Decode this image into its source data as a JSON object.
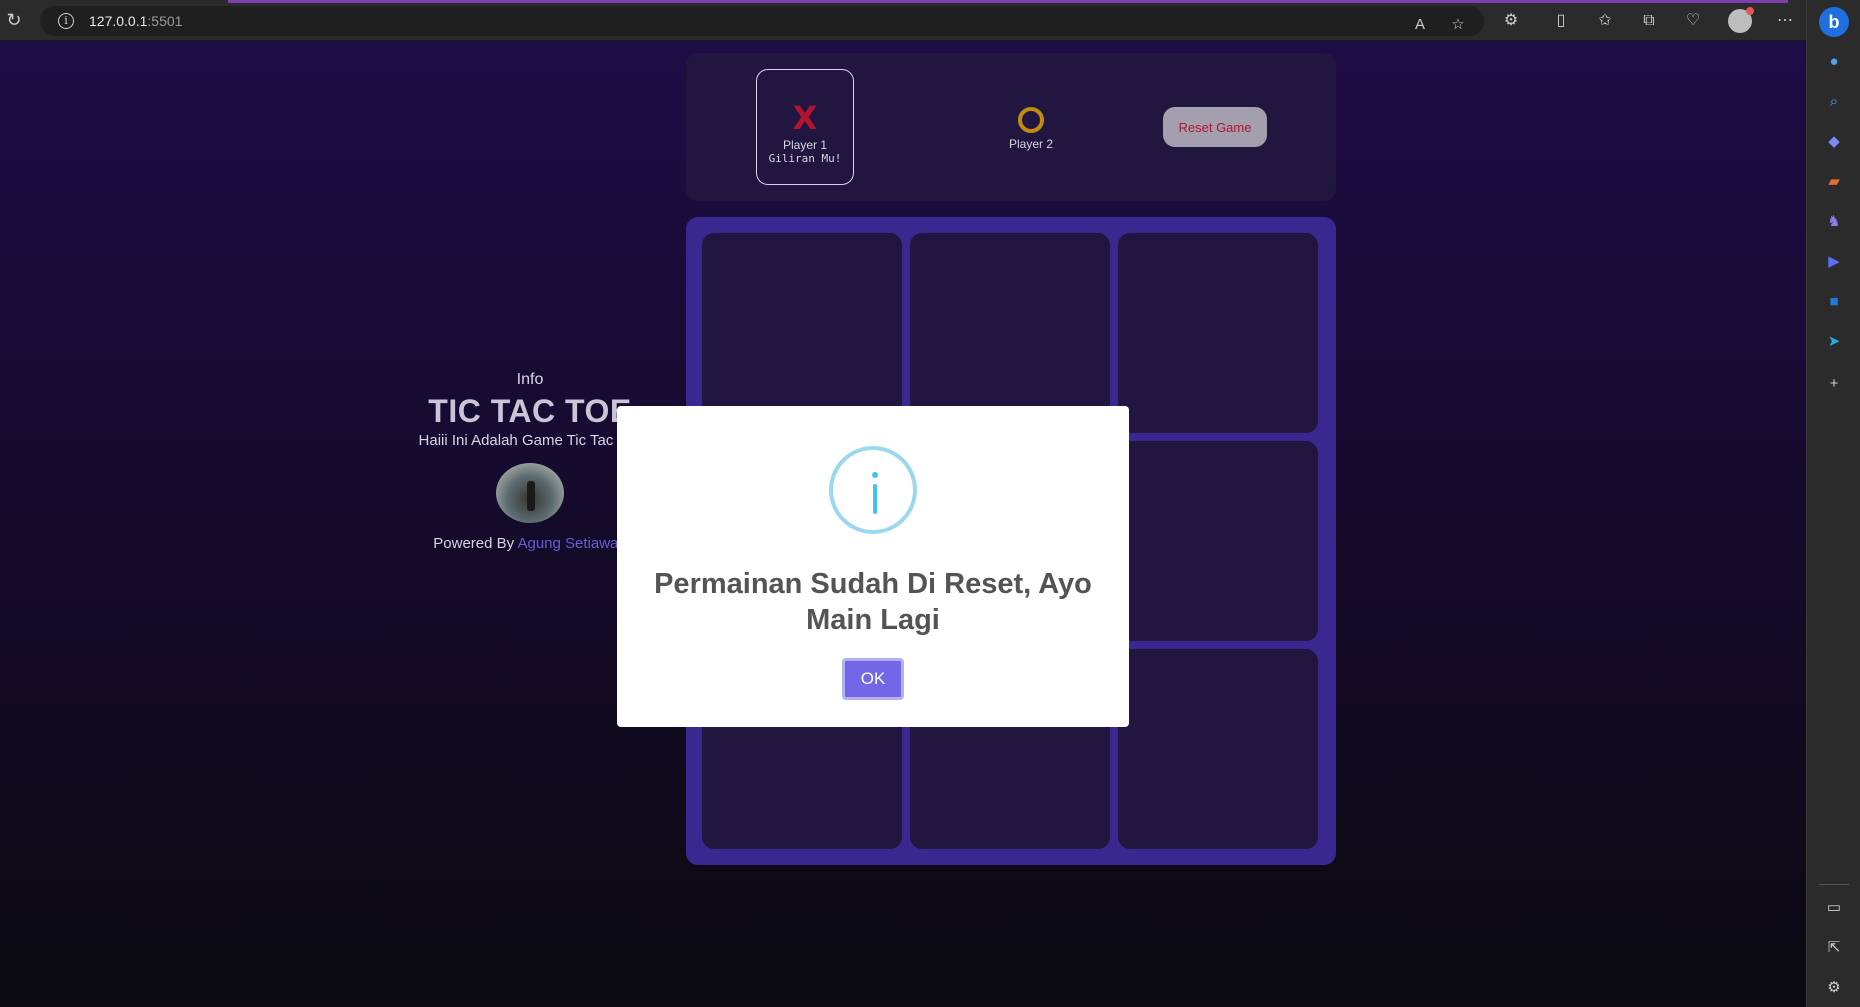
{
  "browser": {
    "url_host": "127.0.0.1",
    "url_port": ":5501"
  },
  "info": {
    "label": "Info",
    "title": "TIC TAC TOE",
    "description": "Haiii Ini Adalah Game Tic Tac Toe",
    "powered_prefix": "Powered By",
    "author": "Agung Setiawan"
  },
  "players": {
    "player1_symbol": "X",
    "player1_name": "Player 1",
    "player1_turn": "Giliran Mu!",
    "player2_name": "Player 2"
  },
  "controls": {
    "reset_label": "Reset Game"
  },
  "modal": {
    "message": "Permainan Sudah Di Reset, Ayo Main Lagi",
    "ok_label": "OK"
  },
  "colors": {
    "x_color": "#b3132f",
    "o_color": "#c38a10",
    "board": "#3a2891",
    "accent": "#7367e8"
  }
}
